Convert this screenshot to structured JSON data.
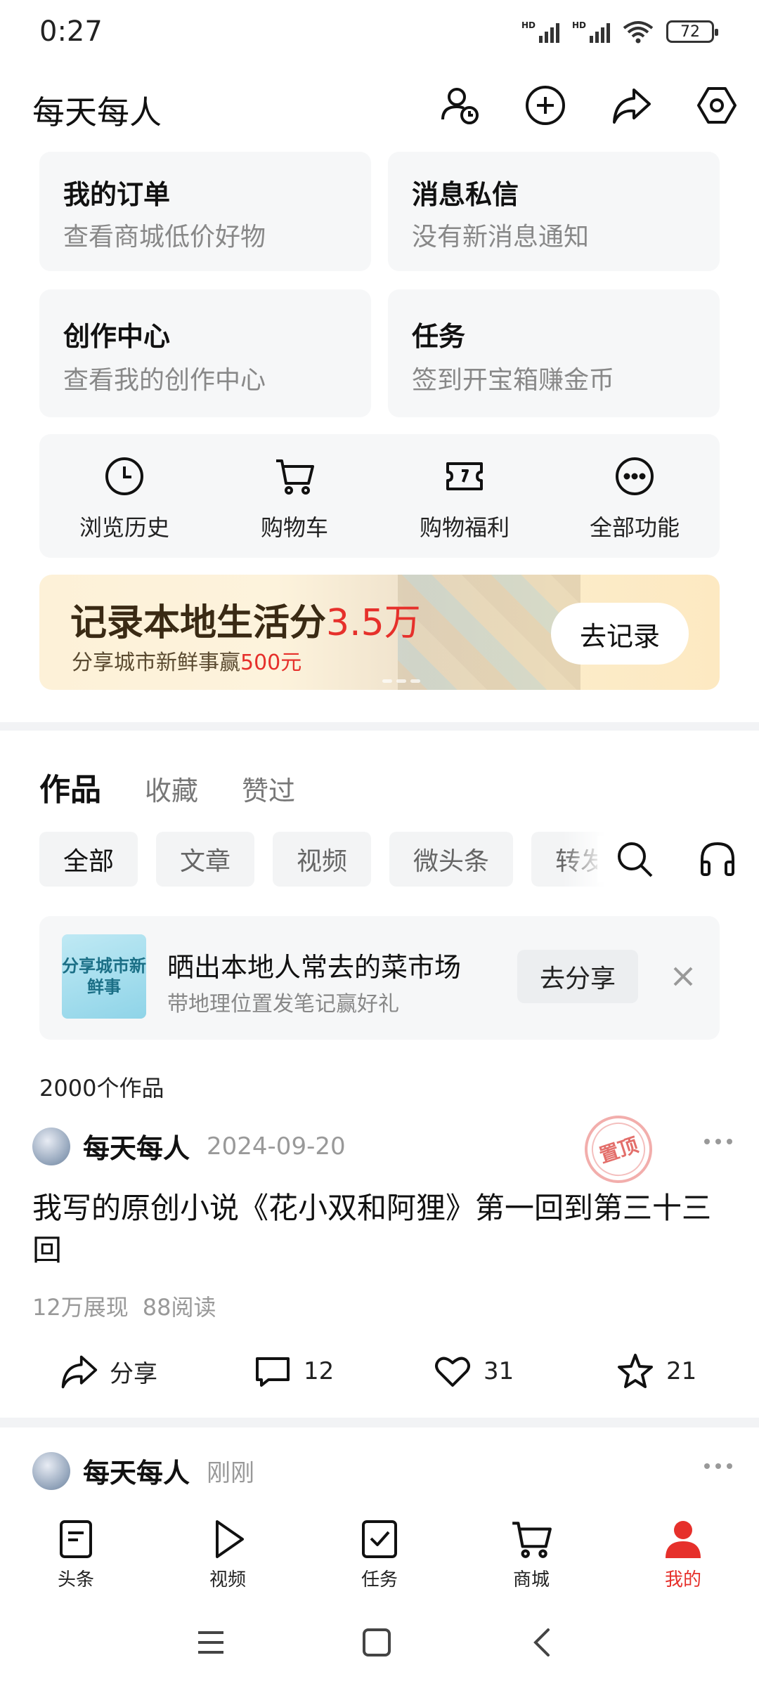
{
  "status": {
    "time": "0:27",
    "battery": "72",
    "signal_label": "HD"
  },
  "header": {
    "title": "每天每人",
    "icons": [
      "user-clock-icon",
      "plus-circle-icon",
      "share-icon",
      "settings-hex-icon"
    ]
  },
  "cards": [
    {
      "title": "我的订单",
      "subtitle": "查看商城低价好物"
    },
    {
      "title": "消息私信",
      "subtitle": "没有新消息通知"
    },
    {
      "title": "创作中心",
      "subtitle": "查看我的创作中心"
    },
    {
      "title": "任务",
      "subtitle": "签到开宝箱赚金币"
    }
  ],
  "quick": [
    {
      "label": "浏览历史",
      "icon": "clock-icon"
    },
    {
      "label": "购物车",
      "icon": "cart-icon"
    },
    {
      "label": "购物福利",
      "icon": "ticket-icon"
    },
    {
      "label": "全部功能",
      "icon": "more-circle-icon"
    }
  ],
  "banner": {
    "title": "记录本地生活分",
    "title_highlight": "3.5万",
    "subtitle": "分享城市新鲜事赢",
    "subtitle_highlight": "500元",
    "button": "去记录"
  },
  "tabs": [
    {
      "label": "作品",
      "active": true
    },
    {
      "label": "收藏",
      "active": false
    },
    {
      "label": "赞过",
      "active": false
    }
  ],
  "chips": [
    {
      "label": "全部",
      "active": true
    },
    {
      "label": "文章",
      "active": false
    },
    {
      "label": "视频",
      "active": false
    },
    {
      "label": "微头条",
      "active": false
    },
    {
      "label": "转发",
      "active": false
    }
  ],
  "share_card": {
    "thumb_text": "分享城市新鲜事",
    "title": "晒出本地人常去的菜市场",
    "desc": "带地理位置发笔记赢好礼",
    "button": "去分享"
  },
  "works_count": "2000个作品",
  "post": {
    "author": "每天每人",
    "date": "2024-09-20",
    "stamp": "置顶",
    "title": "我写的原创小说《花小双和阿狸》第一回到第三十三回",
    "views": "12万展现",
    "reads": "88阅读",
    "share_label": "分享",
    "comments": "12",
    "likes": "31",
    "favorites": "21"
  },
  "post2": {
    "author": "每天每人",
    "date": "刚刚"
  },
  "bottom_nav": [
    {
      "label": "头条",
      "icon": "news-icon",
      "active": false
    },
    {
      "label": "视频",
      "icon": "play-icon",
      "active": false
    },
    {
      "label": "任务",
      "icon": "task-check-icon",
      "active": false
    },
    {
      "label": "商城",
      "icon": "mall-cart-icon",
      "active": false
    },
    {
      "label": "我的",
      "icon": "profile-icon",
      "active": true
    }
  ],
  "colors": {
    "accent": "#e6302b",
    "card_bg": "#f6f7f8",
    "muted_text": "#888888"
  }
}
